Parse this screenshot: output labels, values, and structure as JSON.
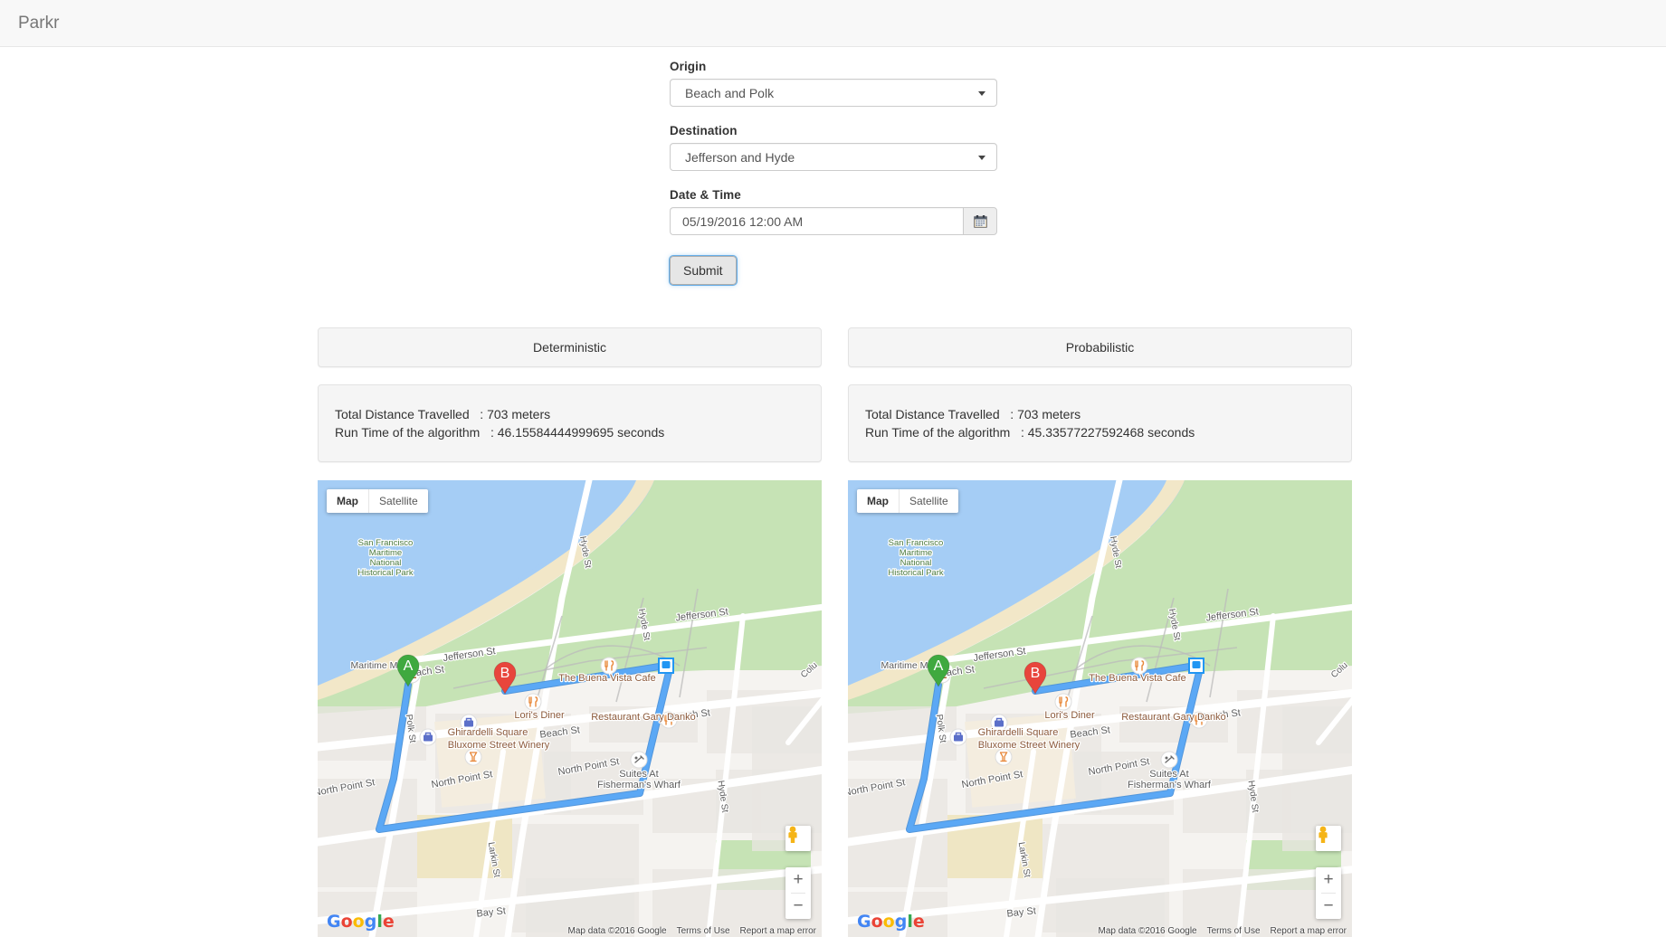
{
  "navbar": {
    "brand": "Parkr"
  },
  "form": {
    "origin": {
      "label": "Origin",
      "value": "Beach and Polk",
      "caret_icon": "chevron-down-icon"
    },
    "destination": {
      "label": "Destination",
      "value": "Jefferson and Hyde",
      "caret_icon": "chevron-down-icon"
    },
    "datetime": {
      "label": "Date & Time",
      "value": "05/19/2016 12:00 AM",
      "placeholder": "05/19/2016 12:00 AM",
      "button_icon": "calendar-icon"
    },
    "submit_label": "Submit"
  },
  "results": [
    {
      "title": "Deterministic",
      "stats": [
        "Total Distance Travelled   : 703 meters",
        "Run Time of the algorithm   : 46.15584444999695 seconds"
      ],
      "distance_meters": 703,
      "run_time_seconds": "46.15584444999695"
    },
    {
      "title": "Probabilistic",
      "stats": [
        "Total Distance Travelled   : 703 meters",
        "Run Time of the algorithm   : 45.33577227592468 seconds"
      ],
      "distance_meters": 703,
      "run_time_seconds": "45.33577227592468"
    }
  ],
  "map": {
    "type_controls": {
      "map": "Map",
      "satellite": "Satellite"
    },
    "markers": {
      "origin": "A",
      "destination": "B"
    },
    "park_label": "San Francisco\nMaritime\nNational\nHistorical Park",
    "park_label_lines": [
      "San Francisco",
      "Maritime",
      "National",
      "Historical Park"
    ],
    "labels": {
      "jefferson_1": "Jefferson St",
      "jefferson_2": "Jefferson St",
      "hyde_1": "Hyde St",
      "hyde_2": "Hyde St",
      "hyde_3": "Hyde St",
      "beach_1": "Beach St",
      "beach_2": "Beach St",
      "beach_3": "Beach St",
      "polk": "Polk St",
      "north_point_1": "North Point St",
      "north_point_2": "North Point St",
      "north_point_3": "North Point St",
      "larkin": "Larkin St",
      "bay": "Bay St",
      "columbus": "Colu",
      "maritime_museum": "Maritime Mus",
      "buena_vista": "The Buena Vista Cafe",
      "loris_diner": "Lori's Diner",
      "gary_danko": "Restaurant Gary Danko",
      "ghirardelli": "Ghirardelli Square",
      "bluxome": "Bluxome Street Winery",
      "suites": "Suites At\nFisherman's Wharf",
      "suites_line1": "Suites At",
      "suites_line2": "Fisherman's Wharf"
    },
    "zoom_controls": {
      "in": "+",
      "out": "−",
      "pegman_icon": "pegman-icon"
    },
    "logo": {
      "text": "Google",
      "letters": [
        "G",
        "o",
        "o",
        "g",
        "l",
        "e"
      ],
      "colors": [
        "#4285F4",
        "#EA4335",
        "#FBBC05",
        "#4285F4",
        "#34A853",
        "#EA4335"
      ]
    },
    "attribution": {
      "map_data": "Map data ©2016 Google",
      "terms": "Terms of Use",
      "report": "Report a map error"
    },
    "colors": {
      "route": "#5BA8F5",
      "water": "#A5CDF5",
      "park": "#C6E3B5",
      "sand": "#F2E7C8",
      "land": "#F5F3F0",
      "road": "#FFFFFF",
      "building": "#E8E6E1",
      "marker_a": "#3FA93F",
      "marker_b": "#E8453C"
    }
  }
}
